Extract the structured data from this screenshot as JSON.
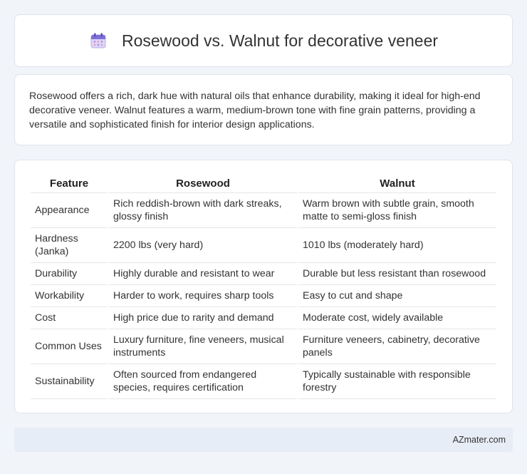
{
  "header": {
    "title": "Rosewood vs. Walnut for decorative veneer",
    "icon": "calendar-icon"
  },
  "intro": {
    "text": "Rosewood offers a rich, dark hue with natural oils that enhance durability, making it ideal for high-end decorative veneer. Walnut features a warm, medium-brown tone with fine grain patterns, providing a versatile and sophisticated finish for interior design applications."
  },
  "table": {
    "headers": [
      "Feature",
      "Rosewood",
      "Walnut"
    ],
    "rows": [
      [
        "Appearance",
        "Rich reddish-brown with dark streaks, glossy finish",
        "Warm brown with subtle grain, smooth matte to semi-gloss finish"
      ],
      [
        "Hardness (Janka)",
        "2200 lbs (very hard)",
        "1010 lbs (moderately hard)"
      ],
      [
        "Durability",
        "Highly durable and resistant to wear",
        "Durable but less resistant than rosewood"
      ],
      [
        "Workability",
        "Harder to work, requires sharp tools",
        "Easy to cut and shape"
      ],
      [
        "Cost",
        "High price due to rarity and demand",
        "Moderate cost, widely available"
      ],
      [
        "Common Uses",
        "Luxury furniture, fine veneers, musical instruments",
        "Furniture veneers, cabinetry, decorative panels"
      ],
      [
        "Sustainability",
        "Often sourced from endangered species, requires certification",
        "Typically sustainable with responsible forestry"
      ]
    ]
  },
  "footer": {
    "brand": "AZmater.com"
  },
  "colors": {
    "background": "#f1f4f9",
    "footer_bg": "#e7edf7"
  }
}
